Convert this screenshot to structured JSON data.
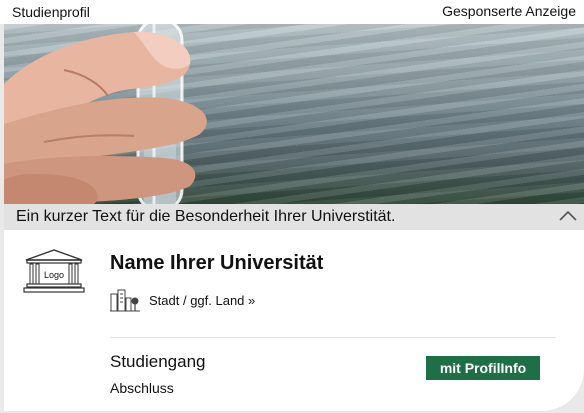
{
  "topbar": {
    "left_label": "Studienprofil",
    "right_label": "Gesponserte Anzeige"
  },
  "hero": {
    "image": "hand holding glass test tube in front of water surface",
    "caption": "Ein kurzer Text für die Besonderheit Ihrer Universtität.",
    "toggle_icon": "chevron-up-icon"
  },
  "university": {
    "logo_text": "Logo",
    "logo_icon": "building-icon",
    "name": "Name Ihrer Universität",
    "city_icon": "city-icon",
    "city_link": "Stadt / ggf. Land »"
  },
  "program": {
    "course": "Studiengang",
    "degree": "Abschluss",
    "button_label": "mit ProfilInfo"
  },
  "colors": {
    "button_bg": "#1e6f45",
    "button_text": "#ffffff",
    "panel_bg": "#ffffff",
    "frame_bg": "#e9e9e9"
  }
}
